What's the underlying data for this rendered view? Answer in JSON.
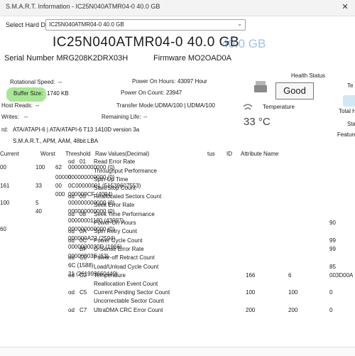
{
  "window": {
    "title": "S.M.A.R.T. Information - IC25N040ATMR04-0 40.0 GB",
    "close_glyph": "✕"
  },
  "disk": {
    "label": "Select Hard Disk:",
    "value": "IC25N040ATMR04-0 40.0 GB"
  },
  "header": {
    "model": "IC25N040ATMR04-0 40.0 GB",
    "model_ghost": "40.0 GB",
    "serial": "Serial Number MRG208K2DRX03H",
    "firmware": "Firmware MO2OAD0A"
  },
  "info": {
    "rotational_speed_label": "Rotational Speed:",
    "rotational_speed_value": "--",
    "buffer_size_label": "Buffer Size:",
    "buffer_size_value": "1740 KB",
    "host_reads_label": "Host Reads:",
    "host_reads_value": "--",
    "writes_label": "Writes:",
    "writes_value": "--",
    "standard_label": "rd:",
    "standard_value": "ATA/ATAPI-6 | ATA/ATAPI-6 T13 1410D version 3a",
    "features_value": "S.M.A.R.T., APM, AAM, 48bit LBA",
    "power_on_hours_label": "Power On Hours:",
    "power_on_hours_value": "43097 Hour",
    "power_on_count_label": "Power On Count:",
    "power_on_count_value": "23947",
    "transfer_mode_label": "Transfer Mode:",
    "transfer_mode_value": "UDMA/100 | UDMA/100",
    "remaining_life_label": "Remaining Life:",
    "remaining_life_value": "--"
  },
  "health": {
    "title": "Health Status",
    "status": "Good",
    "temp_title": "Temperature",
    "temp_value": "33 °C"
  },
  "right_edge": {
    "t1": "Te",
    "t2": "Total H",
    "t3": "Sta",
    "t4": "Feature"
  },
  "smart_table": {
    "headers_left": [
      "Current",
      "Worst",
      "Threshold",
      "Raw Values(Decimal)"
    ],
    "headers_right": [
      "tus",
      "ID",
      "Attribute Name"
    ],
    "rows_left": [
      {
        "cur": "00",
        "worst": "100",
        "thr": "62",
        "raw": "000000000000 (0)"
      },
      {
        "cur": "",
        "worst": "",
        "thr": "00000",
        "raw": "000000000000 (0)"
      },
      {
        "cur": "161",
        "worst": "33",
        "thr": "00",
        "raw": "0C00000001 (51539607553)"
      },
      {
        "cur": "",
        "worst": "",
        "thr": "000",
        "raw": "000009CF (4094)"
      },
      {
        "cur": "100",
        "worst": "5",
        "thr": "",
        "raw": "000000000000 (0)"
      },
      {
        "cur": "",
        "worst": "40",
        "thr": "",
        "raw": "000000000000 (0)"
      },
      {
        "cur": "",
        "worst": "",
        "thr": "",
        "raw": "00000001180 (43097)"
      },
      {
        "cur": "60",
        "worst": "",
        "thr": "",
        "raw": "000000000000 (0)"
      },
      {
        "cur": "",
        "worst": "",
        "thr": "",
        "raw": "000000A22 (2594)"
      },
      {
        "cur": "",
        "worst": "",
        "thr": "",
        "raw": "0000000030D (1966)"
      },
      {
        "cur": "",
        "worst": "",
        "thr": "",
        "raw": "00000003F (63)"
      },
      {
        "cur": "",
        "worst": "",
        "thr": "",
        "raw": "6C (1588)"
      },
      {
        "cur": "",
        "worst": "",
        "thr": "",
        "raw": "21 (261993660449)"
      }
    ],
    "rows_right": [
      {
        "st": "od",
        "id": "01",
        "name": "Read Error Rate"
      },
      {
        "st": "",
        "id": "",
        "name": "Throughput Performance"
      },
      {
        "st": "",
        "id": "",
        "name": "Spin-Up Time"
      },
      {
        "st": "",
        "id": "",
        "name": "Start/Stop Count"
      },
      {
        "st": "od",
        "id": "05",
        "name": "Reallocated Sectors Count"
      },
      {
        "st": "",
        "id": "",
        "name": "Seek Error Rate"
      },
      {
        "st": "od",
        "id": "08",
        "name": "Seek Time Performance"
      },
      {
        "st": "",
        "id": "",
        "name": "Power-On Hours"
      },
      {
        "st": "od",
        "id": "0A",
        "name": "Spin Retry Count"
      },
      {
        "st": "od",
        "id": "0C",
        "name": "Power Cycle Count"
      },
      {
        "st": "",
        "id": "BF",
        "name": "G-Sense Error Rate"
      },
      {
        "st": "od",
        "id": "C0",
        "name": "Power-off Retract Count"
      },
      {
        "st": "",
        "id": "",
        "name": "Load/Unload Cycle Count"
      },
      {
        "st": "od",
        "id": "C2",
        "name": "Temperature"
      },
      {
        "st": "",
        "id": "",
        "name": "Reallocation Event Count"
      },
      {
        "st": "od",
        "id": "C5",
        "name": "Current Pending Sector Count"
      },
      {
        "st": "",
        "id": "",
        "name": "Uncorrectable Sector Count"
      },
      {
        "st": "od",
        "id": "C7",
        "name": "UltraDMA CRC Error Count"
      }
    ],
    "right_vals": [
      {
        "a": "",
        "b": "",
        "c": ""
      },
      {
        "a": "",
        "b": "",
        "c": ""
      },
      {
        "a": "",
        "b": "",
        "c": ""
      },
      {
        "a": "",
        "b": "",
        "c": ""
      },
      {
        "a": "",
        "b": "",
        "c": ""
      },
      {
        "a": "",
        "b": "",
        "c": ""
      },
      {
        "a": "",
        "b": "",
        "c": ""
      },
      {
        "a": "",
        "b": "",
        "c": "90"
      },
      {
        "a": "",
        "b": "",
        "c": ""
      },
      {
        "a": "",
        "b": "",
        "c": "99"
      },
      {
        "a": "",
        "b": "",
        "c": "99"
      },
      {
        "a": "",
        "b": "",
        "c": ""
      },
      {
        "a": "",
        "b": "",
        "c": "85"
      },
      {
        "a": "166",
        "b": "6",
        "c": "003D00A"
      },
      {
        "a": "",
        "b": "",
        "c": ""
      },
      {
        "a": "100",
        "b": "100",
        "c": "0"
      },
      {
        "a": "",
        "b": "",
        "c": ""
      },
      {
        "a": "200",
        "b": "200",
        "c": "0"
      }
    ]
  },
  "colors": {
    "buffer_highlight": "#9ee48a",
    "accent": "#4f8fd8"
  }
}
